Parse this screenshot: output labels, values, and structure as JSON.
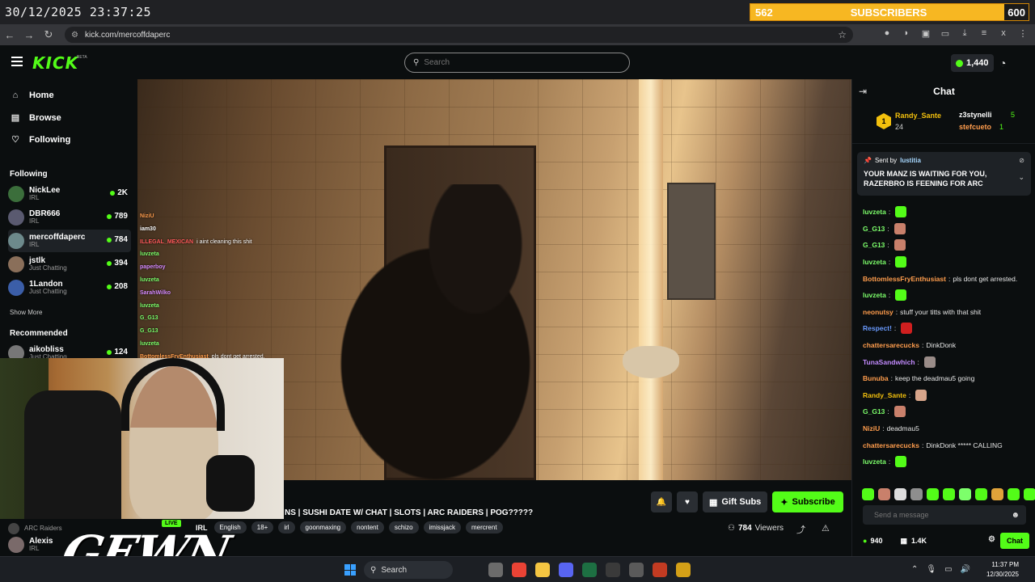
{
  "overlay": {
    "timestamp": "30/12/2025 23:37:25",
    "sub_goal": {
      "current": "562",
      "label": "SUBSCRIBERS",
      "target": "600",
      "progress": 0.937
    }
  },
  "browser": {
    "url": "kick.com/mercoffdaperc"
  },
  "header": {
    "logo": "KICK",
    "logo_badge": "BETA",
    "search_placeholder": "Search",
    "kicks_balance": "1,440"
  },
  "sidebar": {
    "nav": [
      {
        "label": "Home",
        "icon": "home-icon"
      },
      {
        "label": "Browse",
        "icon": "browse-icon"
      },
      {
        "label": "Following",
        "icon": "heart-icon"
      }
    ],
    "following_title": "Following",
    "following": [
      {
        "name": "NickLee",
        "category": "IRL",
        "viewers": "2K"
      },
      {
        "name": "DBR666",
        "category": "IRL",
        "viewers": "789"
      },
      {
        "name": "mercoffdaperc",
        "category": "IRL",
        "viewers": "784"
      },
      {
        "name": "jstlk",
        "category": "Just Chatting",
        "viewers": "394"
      },
      {
        "name": "1Landon",
        "category": "Just Chatting",
        "viewers": "208"
      }
    ],
    "show_more": "Show More",
    "recommended_title": "Recommended",
    "recommended": [
      {
        "name": "aikobliss",
        "category": "Just Chatting",
        "viewers": "124"
      }
    ],
    "bottom": [
      {
        "name": "ARC Raiders",
        "category": ""
      },
      {
        "name": "Alexis",
        "category": "IRL"
      }
    ]
  },
  "video_chat": [
    {
      "user": "NiziU",
      "text": "",
      "cls": "o"
    },
    {
      "user": "iam30",
      "text": "",
      "cls": ""
    },
    {
      "user": "ILLEGAL_MEXICAN",
      "text": "i aint cleaning this shit",
      "cls": "r"
    },
    {
      "user": "luvzeta",
      "text": "",
      "cls": "g"
    },
    {
      "user": "paperboy",
      "text": "",
      "cls": "p"
    },
    {
      "user": "luvzeta",
      "text": "",
      "cls": "g"
    },
    {
      "user": "SarahWilko",
      "text": "",
      "cls": "p"
    },
    {
      "user": "luvzeta",
      "text": "",
      "cls": "g"
    },
    {
      "user": "G_G13",
      "text": "",
      "cls": "g"
    },
    {
      "user": "G_G13",
      "text": "",
      "cls": "g"
    },
    {
      "user": "luvzeta",
      "text": "",
      "cls": "g"
    },
    {
      "user": "BottomlessFryEnthusiast",
      "text": "pls dont get arrested.",
      "cls": "o"
    }
  ],
  "webcam_overlay": {
    "brand": "GEWN",
    "live": "LIVE"
  },
  "stream": {
    "title": "NS | SUSHI DATE W/ CHAT | SLOTS | ARC RAIDERS | POG?????",
    "category": "IRL",
    "tags": [
      "English",
      "18+",
      "irl",
      "goonmaxing",
      "nontent",
      "schizo",
      "imissjack",
      "mercrent"
    ],
    "viewers": "784",
    "viewers_label": "Viewers",
    "gift_subs_label": "Gift Subs",
    "subscribe_label": "Subscribe"
  },
  "chat": {
    "title": "Chat",
    "leaderboard": {
      "first": {
        "rank": "1",
        "name": "Randy_Sante",
        "value": "24"
      },
      "second": {
        "name": "z3stynelli",
        "value": "5"
      },
      "third": {
        "name": "stefcueto",
        "value": "1"
      }
    },
    "pinned": {
      "sent_by_label": "Sent by",
      "sender": "lustitia",
      "message": "YOUR MANZ IS WAITING FOR YOU, RAZERBRO IS FEENING FOR ARC"
    },
    "messages": [
      {
        "user": "luvzeta",
        "text": "",
        "color": "#7dff6b",
        "emote": "#53fc18"
      },
      {
        "user": "G_G13",
        "text": "",
        "color": "#7dff6b",
        "emote": "#c9806b"
      },
      {
        "user": "G_G13",
        "text": "",
        "color": "#7dff6b",
        "emote": "#c9806b"
      },
      {
        "user": "luvzeta",
        "text": "",
        "color": "#7dff6b",
        "emote": "#53fc18"
      },
      {
        "user": "BottomlessFryEnthusiast",
        "text": "pls dont get arrested.",
        "color": "#ff9d4d",
        "emote": ""
      },
      {
        "user": "luvzeta",
        "text": "",
        "color": "#7dff6b",
        "emote": "#53fc18"
      },
      {
        "user": "neonutsy",
        "text": "stuff your titts with that shit",
        "color": "#ff9d4d",
        "emote": ""
      },
      {
        "user": "Respect!",
        "text": "",
        "color": "#6a9bff",
        "emote": "#d01f1f"
      },
      {
        "user": "chattersarecucks",
        "text": "DinkDonk",
        "color": "#ff9d4d",
        "emote": ""
      },
      {
        "user": "TunaSandwhich",
        "text": "",
        "color": "#c38bff",
        "emote": "#9a8c88"
      },
      {
        "user": "Bunuba",
        "text": "keep the deadmau5 going",
        "color": "#ff9d4d",
        "emote": ""
      },
      {
        "user": "Randy_Sante",
        "text": "",
        "color": "#f3c00d",
        "emote": "#d8a58a"
      },
      {
        "user": "G_G13",
        "text": "",
        "color": "#7dff6b",
        "emote": "#c9806b"
      },
      {
        "user": "NiziU",
        "text": "deadmau5",
        "color": "#ff9d4d",
        "emote": ""
      },
      {
        "user": "chattersarecucks",
        "text": "DinkDonk ***** CALLING",
        "color": "#ff9d4d",
        "emote": ""
      },
      {
        "user": "luvzeta",
        "text": "",
        "color": "#7dff6b",
        "emote": "#53fc18"
      }
    ],
    "input_placeholder": "Send a message",
    "kicks": "940",
    "points": "1.4K",
    "chat_button": "Chat"
  },
  "taskbar": {
    "search_label": "Search",
    "time": "11:37 PM",
    "date": "12/30/2025"
  },
  "colors": {
    "accent": "#53fc18",
    "background": "#0b0e0f",
    "goal_bar": "#f3a80d"
  }
}
